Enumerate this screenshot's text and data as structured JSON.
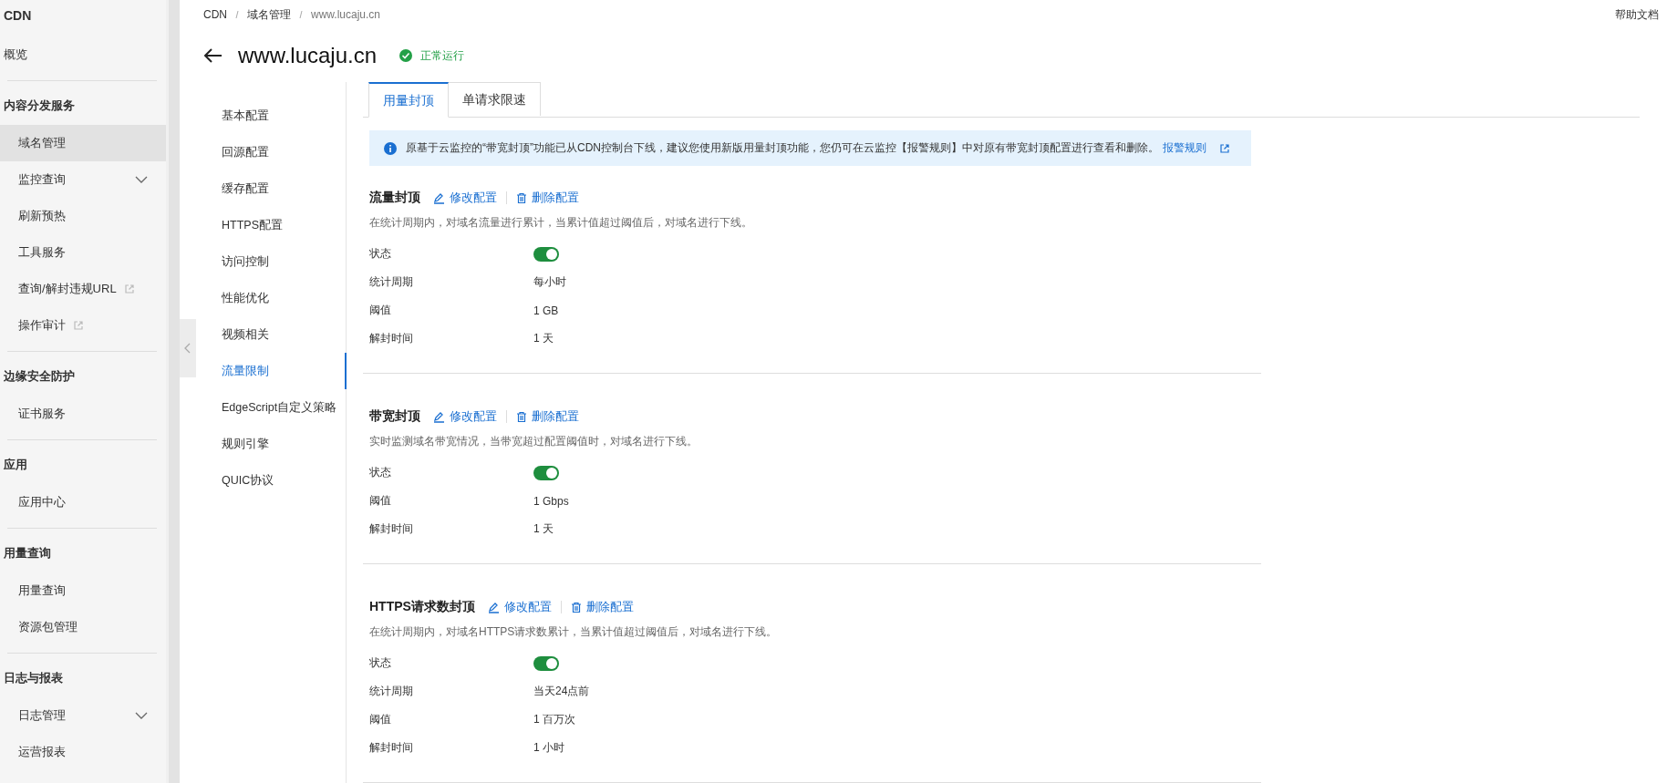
{
  "sidebar": {
    "title": "CDN",
    "top_items": [
      {
        "label": "概览",
        "kind": "link",
        "selected": false
      }
    ],
    "groups": [
      {
        "title": "内容分发服务",
        "items": [
          {
            "label": "域名管理",
            "kind": "link",
            "selected": true
          },
          {
            "label": "监控查询",
            "kind": "menu",
            "selected": false
          },
          {
            "label": "刷新预热",
            "kind": "link",
            "selected": false
          },
          {
            "label": "工具服务",
            "kind": "link",
            "selected": false
          },
          {
            "label": "查询/解封违规URL",
            "kind": "external",
            "selected": false
          },
          {
            "label": "操作审计",
            "kind": "external",
            "selected": false
          }
        ]
      },
      {
        "title": "边缘安全防护",
        "items": [
          {
            "label": "证书服务",
            "kind": "link",
            "selected": false
          }
        ]
      },
      {
        "title": "应用",
        "items": [
          {
            "label": "应用中心",
            "kind": "link",
            "selected": false
          }
        ]
      },
      {
        "title": "用量查询",
        "items": [
          {
            "label": "用量查询",
            "kind": "link",
            "selected": false
          },
          {
            "label": "资源包管理",
            "kind": "link",
            "selected": false
          }
        ]
      },
      {
        "title": "日志与报表",
        "items": [
          {
            "label": "日志管理",
            "kind": "menu",
            "selected": false
          },
          {
            "label": "运营报表",
            "kind": "link",
            "selected": false
          }
        ]
      }
    ]
  },
  "breadcrumb": [
    "CDN",
    "域名管理",
    "www.lucaju.cn"
  ],
  "help_link": "帮助文档",
  "header": {
    "title": "www.lucaju.cn",
    "status": "正常运行"
  },
  "domain_nav": [
    {
      "label": "基本配置",
      "selected": false
    },
    {
      "label": "回源配置",
      "selected": false
    },
    {
      "label": "缓存配置",
      "selected": false
    },
    {
      "label": "HTTPS配置",
      "selected": false
    },
    {
      "label": "访问控制",
      "selected": false
    },
    {
      "label": "性能优化",
      "selected": false
    },
    {
      "label": "视频相关",
      "selected": false
    },
    {
      "label": "流量限制",
      "selected": true
    },
    {
      "label": "EdgeScript自定义策略",
      "selected": false
    },
    {
      "label": "规则引擎",
      "selected": false
    },
    {
      "label": "QUIC协议",
      "selected": false
    }
  ],
  "tabs": [
    {
      "label": "用量封顶",
      "selected": true
    },
    {
      "label": "单请求限速",
      "selected": false
    }
  ],
  "notice": {
    "text": "原基于云监控的“带宽封顶”功能已从CDN控制台下线，建议您使用新版用量封顶功能，您仍可在云监控【报警规则】中对原有带宽封顶配置进行查看和删除。",
    "link": "报警规则"
  },
  "sections": [
    {
      "title": "流量封顶",
      "edit": "修改配置",
      "delete": "删除配置",
      "description": "在统计周期内，对域名流量进行累计，当累计值超过阈值后，对域名进行下线。",
      "fields": [
        {
          "label": "状态",
          "kind": "switch",
          "on": true
        },
        {
          "label": "统计周期",
          "kind": "text",
          "value": "每小时"
        },
        {
          "label": "阈值",
          "kind": "text",
          "value": "1 GB"
        },
        {
          "label": "解封时间",
          "kind": "text",
          "value": "1 天"
        }
      ]
    },
    {
      "title": "带宽封顶",
      "edit": "修改配置",
      "delete": "删除配置",
      "description": "实时监测域名带宽情况，当带宽超过配置阈值时，对域名进行下线。",
      "fields": [
        {
          "label": "状态",
          "kind": "switch",
          "on": true
        },
        {
          "label": "阈值",
          "kind": "text",
          "value": "1 Gbps"
        },
        {
          "label": "解封时间",
          "kind": "text",
          "value": "1 天"
        }
      ]
    },
    {
      "title": "HTTPS请求数封顶",
      "edit": "修改配置",
      "delete": "删除配置",
      "description": "在统计周期内，对域名HTTPS请求数累计，当累计值超过阈值后，对域名进行下线。",
      "fields": [
        {
          "label": "状态",
          "kind": "switch",
          "on": true
        },
        {
          "label": "统计周期",
          "kind": "text",
          "value": "当天24点前"
        },
        {
          "label": "阈值",
          "kind": "text",
          "value": "1 百万次"
        },
        {
          "label": "解封时间",
          "kind": "text",
          "value": "1 小时"
        }
      ]
    }
  ]
}
